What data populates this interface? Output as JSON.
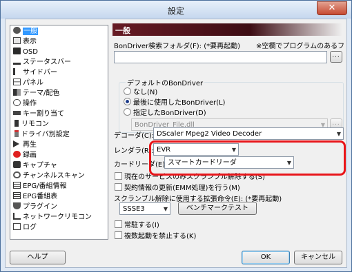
{
  "window": {
    "title": "設定",
    "close_glyph": "✕"
  },
  "sidebar": {
    "items": [
      {
        "label": "一般",
        "selected": true,
        "icon": "gear-icon"
      },
      {
        "label": "表示",
        "icon": "window-icon"
      },
      {
        "label": "OSD",
        "icon": "osd-icon"
      },
      {
        "label": "ステータスバー",
        "icon": "statusbar-icon"
      },
      {
        "label": "サイドバー",
        "icon": "sidebar-icon"
      },
      {
        "label": "パネル",
        "icon": "panel-icon"
      },
      {
        "label": "テーマ/配色",
        "icon": "theme-icon"
      },
      {
        "label": "操作",
        "icon": "operation-icon"
      },
      {
        "label": "キー割り当て",
        "icon": "keyboard-icon"
      },
      {
        "label": "リモコン",
        "icon": "remote-icon"
      },
      {
        "label": "ドライバ別設定",
        "icon": "driver-icon"
      },
      {
        "label": "再生",
        "icon": "play-icon"
      },
      {
        "label": "録画",
        "icon": "record-icon"
      },
      {
        "label": "キャプチャ",
        "icon": "camera-icon"
      },
      {
        "label": "チャンネルスキャン",
        "icon": "scan-icon"
      },
      {
        "label": "EPG/番組情報",
        "icon": "epg-icon"
      },
      {
        "label": "EPG番組表",
        "icon": "epg-table-icon"
      },
      {
        "label": "プラグイン",
        "icon": "plugin-icon"
      },
      {
        "label": "ネットワークリモコン",
        "icon": "network-icon"
      },
      {
        "label": "ログ",
        "icon": "log-icon"
      }
    ]
  },
  "general": {
    "header": "一般",
    "bondriver_folder_label": "BonDriver検索フォルダ(F): (*要再起動)",
    "bondriver_folder_note": "※空欄でプログラムのあるフォルダ",
    "bondriver_folder_value": "",
    "browse_label": "...",
    "default_bondriver_group": "デフォルトのBonDriver",
    "radio_none": "なし(N)",
    "radio_last": "最後に使用したBonDriver(L)",
    "radio_specified": "指定したBonDriver(D)",
    "bondriver_file": "BonDriver_File.dll",
    "decoder_label": "デコーダ(C):",
    "decoder_value": "DScaler Mpeg2 Video Decoder",
    "renderer_label": "レンダラ(R):",
    "renderer_value": "EVR",
    "card_reader_label": "カードリーダ(E):",
    "card_reader_value": "スマートカードリーダ",
    "chk_descramble_current": "現在のサービスのみスクランブル解除する(S)",
    "chk_emm": "契約情報の更新(EMM処理)を行う(M)",
    "instruction_label": "スクランブル解除に使用する拡張命令(E): (*要再起動)",
    "instruction_value": "SSSE3",
    "benchmark_button": "ベンチマークテスト",
    "chk_resident": "常駐する(I)",
    "chk_no_multiple": "複数起動を禁止する(K)"
  },
  "footer": {
    "help": "ヘルプ",
    "ok": "OK",
    "cancel": "キャンセル"
  },
  "colors": {
    "highlight": "#e8151a",
    "selection": "#3399ff",
    "header": "#661a24"
  }
}
